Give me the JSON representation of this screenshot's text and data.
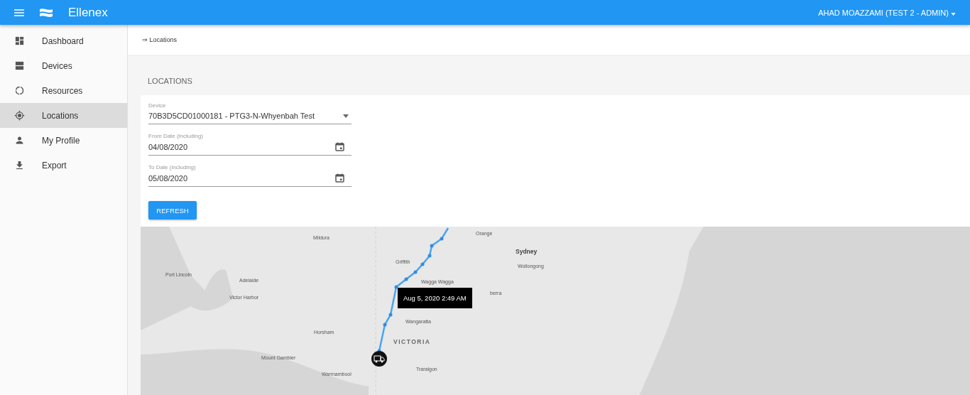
{
  "header": {
    "brand": "Ellenex",
    "user": "AHAD MOAZZAMI (TEST 2 - ADMIN)"
  },
  "sidebar": {
    "items": [
      {
        "label": "Dashboard",
        "selected": false
      },
      {
        "label": "Devices",
        "selected": false
      },
      {
        "label": "Resources",
        "selected": false
      },
      {
        "label": "Locations",
        "selected": true
      },
      {
        "label": "My Profile",
        "selected": false
      },
      {
        "label": "Export",
        "selected": false
      }
    ]
  },
  "breadcrumb": "⇒ Locations",
  "page_title": "LOCATIONS",
  "form": {
    "fields": [
      {
        "kind": "select",
        "label": "Device",
        "value": "70B3D5CD01000181 - PTG3-N-Whyenbah Test"
      },
      {
        "kind": "date",
        "label": "From Date (including)",
        "value": "04/08/2020"
      },
      {
        "kind": "date",
        "label": "To Date (including)",
        "value": "05/08/2020"
      }
    ],
    "button": "REFRESH"
  },
  "map": {
    "labels": [
      {
        "text": "Orange",
        "kind": "city"
      },
      {
        "text": "Sydney",
        "kind": "major"
      },
      {
        "text": "Wollongong",
        "kind": "city"
      },
      {
        "text": "Mildura",
        "kind": "city"
      },
      {
        "text": "Griffith",
        "kind": "city"
      },
      {
        "text": "Port Lincoln",
        "kind": "city"
      },
      {
        "text": "Adelaide",
        "kind": "city"
      },
      {
        "text": "Wagga Wagga",
        "kind": "city"
      },
      {
        "text": "berra",
        "kind": "city"
      },
      {
        "text": "Victor Harbor",
        "kind": "city"
      },
      {
        "text": "Wangaratta",
        "kind": "city"
      },
      {
        "text": "Horsham",
        "kind": "city"
      },
      {
        "text": "VICTORIA",
        "kind": "region"
      },
      {
        "text": "Mount Gambier",
        "kind": "city"
      },
      {
        "text": "Traralgon",
        "kind": "city"
      },
      {
        "text": "Warrnambool",
        "kind": "city"
      }
    ],
    "tooltip": "Aug 5, 2020 2:49 AM"
  }
}
